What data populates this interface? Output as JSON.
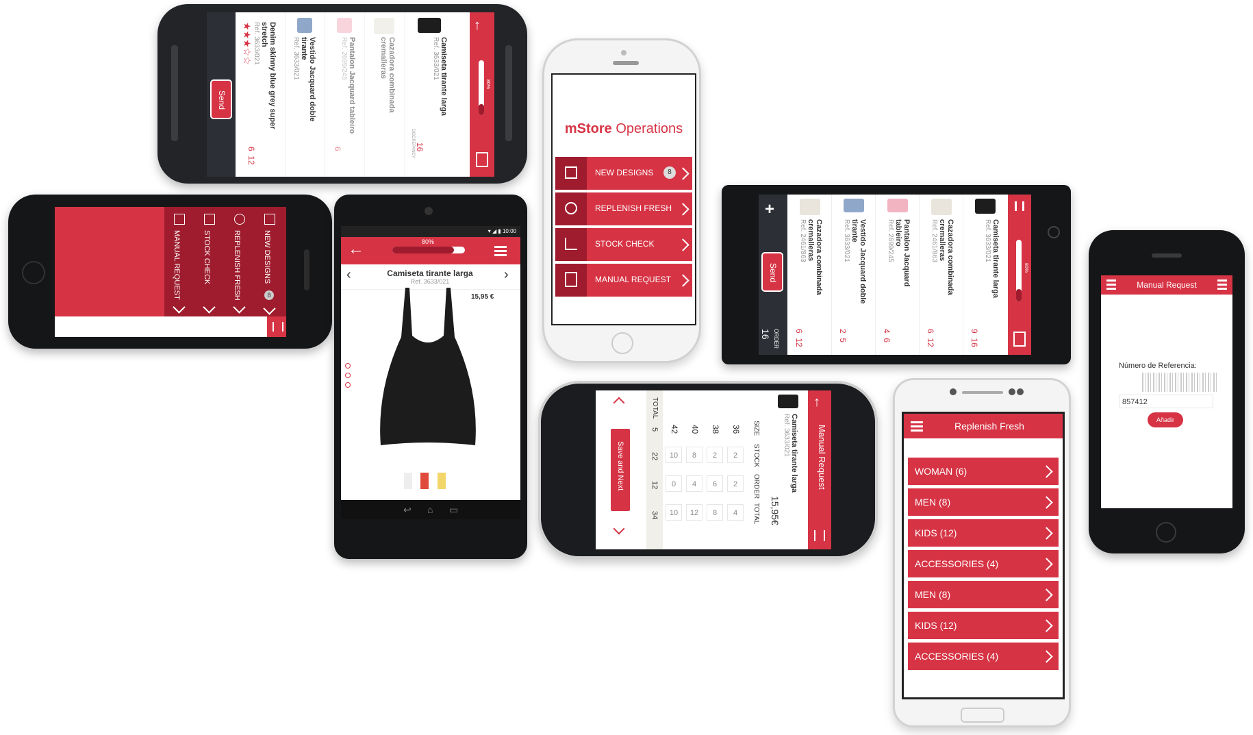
{
  "app": {
    "brand_bold": "mStore",
    "brand_light": "Operations",
    "accent": "#d63445",
    "accent_dark": "#9e1c2d"
  },
  "main_menu": {
    "items": [
      {
        "icon": "bag-icon",
        "label": "NEW DESIGNS",
        "badge": "8"
      },
      {
        "icon": "apple-icon",
        "label": "REPLENISH FRESH"
      },
      {
        "icon": "chart-icon",
        "label": "STOCK CHECK"
      },
      {
        "icon": "clipboard-icon",
        "label": "MANUAL REQUEST"
      }
    ]
  },
  "order_list": {
    "progress_label": "80%",
    "progress": 0.8,
    "send_label": "Send",
    "order_label": "ORDER",
    "total_label": "TOTAL",
    "discrepancy_label": "DISCREPANCY",
    "items_top": [
      {
        "name": "Camiseta tirante larga",
        "ref": "Ref. 3633/021",
        "value_a": "16"
      },
      {
        "name": "Cazadora combinada cremalleras",
        "ref": "",
        "value_a": ""
      },
      {
        "name": "Pantalon Jacquard tableiro",
        "ref": "Ref. 2699/245",
        "value_a": "6"
      },
      {
        "name": "Vestido Jacquard doble tirante",
        "ref": "Ref. 3633/021",
        "value_a": ""
      },
      {
        "name": "Denim skinny blue grey super stretch",
        "ref": "Ref. 3633/021",
        "value_a": "6",
        "value_b": "12",
        "rating": 3
      }
    ],
    "items_mid": [
      {
        "name": "Camiseta tirante larga",
        "ref": "Ref. 3633/021",
        "order": "9",
        "total": "16"
      },
      {
        "name": "Cazadora combinada cremalleras",
        "ref": "Ref. 2461/863",
        "order": "6",
        "total": "12"
      },
      {
        "name": "Pantalon Jacquard tableiro",
        "ref": "Ref. 2699/245",
        "order": "4",
        "total": "6"
      },
      {
        "name": "Vestido Jacquard doble tirante",
        "ref": "Ref. 3633/021",
        "order": "2",
        "total": "5"
      },
      {
        "name": "Cazadora combinada cremalleras",
        "ref": "Ref. 2461/863",
        "order": "6",
        "total": "12"
      }
    ],
    "order_total": "16"
  },
  "product": {
    "title": "Camiseta tirante larga",
    "ref": "Ref. 3633/021",
    "price": "15,95 €",
    "progress_label": "80%"
  },
  "size_table": {
    "title": "Manual Request",
    "product": "Camiseta tirante larga",
    "ref": "Ref. 3633/021",
    "price": "15,95€",
    "headers": [
      "SIZE",
      "STOCK",
      "ORDER",
      "TOTAL"
    ],
    "rows": [
      {
        "size": "36",
        "stock": "2",
        "order": "2",
        "total": "4"
      },
      {
        "size": "38",
        "stock": "2",
        "order": "6",
        "total": "8"
      },
      {
        "size": "40",
        "stock": "8",
        "order": "4",
        "total": "12"
      },
      {
        "size": "42",
        "stock": "10",
        "order": "0",
        "total": "10"
      }
    ],
    "total_label": "TOTAL",
    "totals": {
      "stock": "22",
      "order": "12",
      "total": "34",
      "size": "5"
    },
    "save_label": "Save and Next"
  },
  "replenish": {
    "title": "Replenish Fresh",
    "categories": [
      "WOMAN (6)",
      "MEN (8)",
      "KIDS (12)",
      "ACCESSORIES (4)",
      "MEN (8)",
      "KIDS (12)",
      "ACCESSORIES (4)"
    ]
  },
  "manual": {
    "title": "Manual Request",
    "label": "Número de Referencia:",
    "value": "857412",
    "button": "Añadir"
  },
  "side_menu": {
    "items": [
      "NEW DESIGNS",
      "REPLENISH FRESH",
      "STOCK CHECK",
      "MANUAL REQUEST"
    ],
    "badge": "8"
  }
}
